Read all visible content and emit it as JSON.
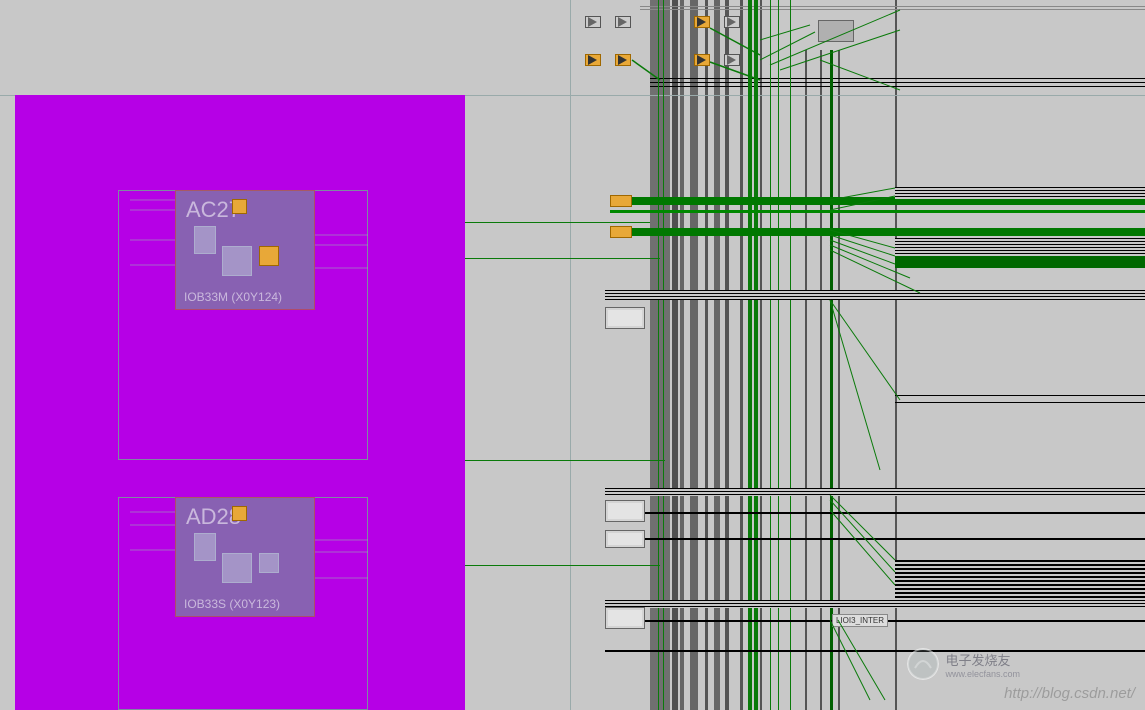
{
  "blocks": {
    "ac27": {
      "title": "AC27",
      "subtitle": "IOB33M (X0Y124)"
    },
    "ad28": {
      "title": "AD28",
      "subtitle": "IOB33S (X0Y123)"
    }
  },
  "interconnect_label": "LIOI3_INTER",
  "watermark_url": "http://blog.csdn.net/",
  "watermark_brand": {
    "name": "电子发烧友",
    "url": "www.elecfans.com"
  },
  "colors": {
    "selection": "#b600e6",
    "wire_active": "#0a7a0a",
    "wire_bus": "#006800",
    "used_bel": "#e8a838",
    "canvas_bg": "#c8c8c8"
  }
}
